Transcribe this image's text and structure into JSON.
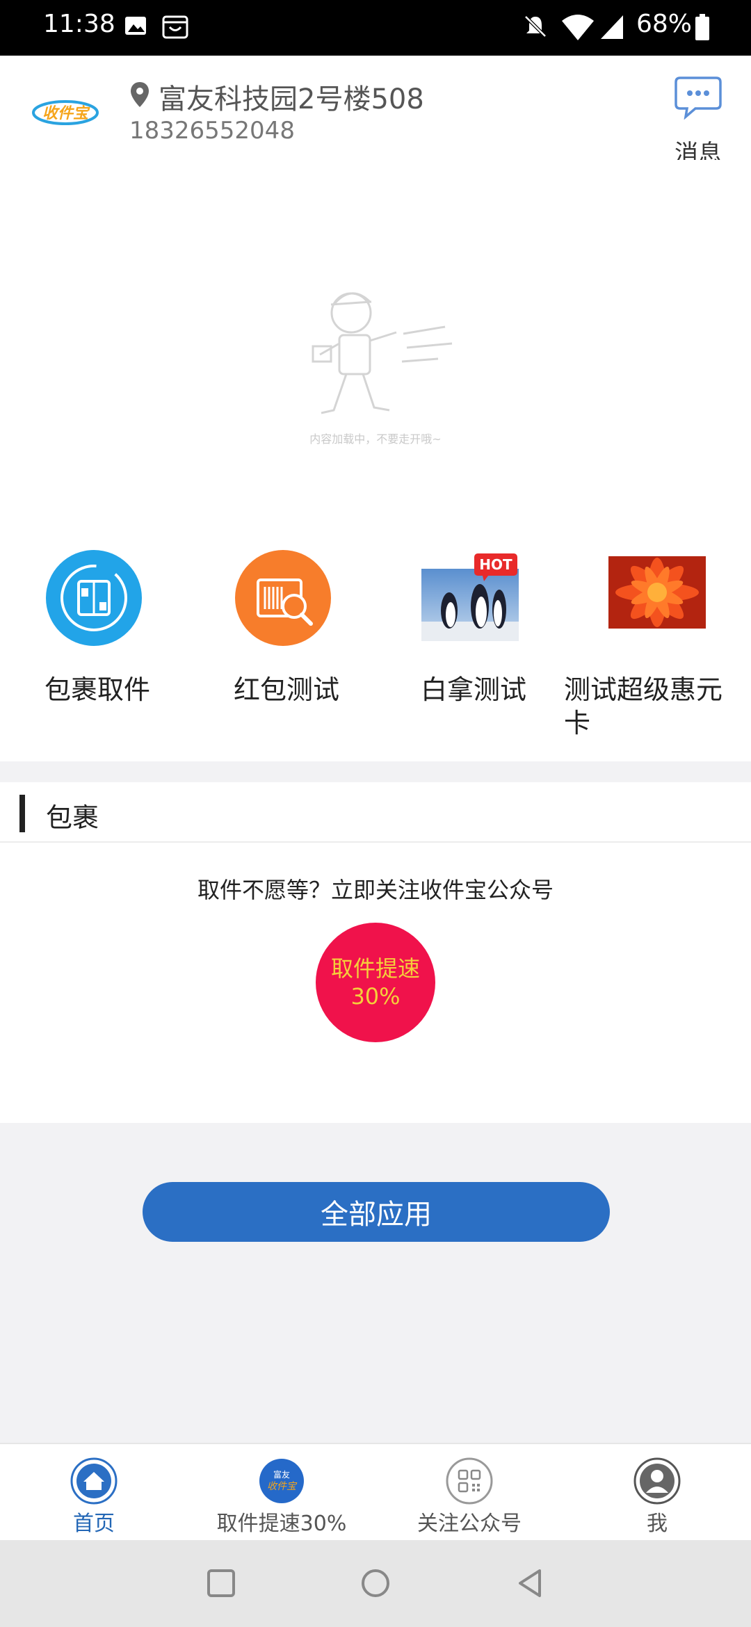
{
  "status_bar": {
    "time": "11:38",
    "battery": "68%"
  },
  "header": {
    "logo_text": "收件宝",
    "address": "富友科技园2号楼508",
    "phone": "18326552048",
    "message_label": "消息"
  },
  "banner": {
    "loading_text": "内容加载中，不要走开哦~"
  },
  "quick_entries": [
    {
      "label": "包裹取件",
      "icon": "package-icon"
    },
    {
      "label": "红包测试",
      "icon": "barcode-search-icon"
    },
    {
      "label": "白拿测试",
      "icon": "penguins-image",
      "badge": "HOT"
    },
    {
      "label": "测试超级惠元卡",
      "icon": "flower-image"
    }
  ],
  "package_section": {
    "title": "包裹",
    "tip": "取件不愿等？立即关注收件宝公众号",
    "speed_line1": "取件提速",
    "speed_line2": "30%"
  },
  "all_apps_label": "全部应用",
  "tabbar": [
    {
      "label": "首页",
      "active": true
    },
    {
      "label": "取件提速30%",
      "active": false,
      "icon_line1": "富友",
      "icon_line2": "收件宝"
    },
    {
      "label": "关注公众号",
      "active": false
    },
    {
      "label": "我",
      "active": false
    }
  ],
  "colors": {
    "accent": "#2b6fc4",
    "speed_circle": "#f0124b",
    "speed_text": "#f5cf3b"
  }
}
